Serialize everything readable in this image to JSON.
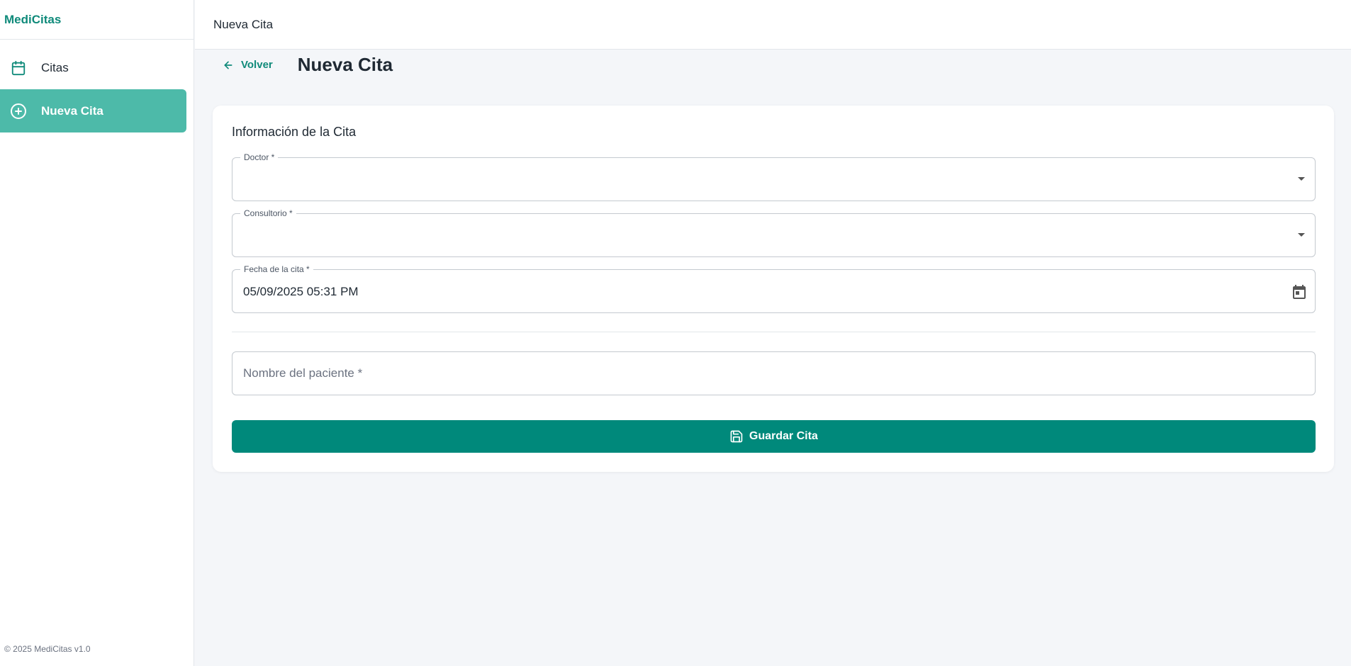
{
  "brand": {
    "name": "MediCitas",
    "color": "#0f8a7a"
  },
  "sidebar": {
    "items": [
      {
        "label": "Citas",
        "icon": "calendar-icon",
        "active": false
      },
      {
        "label": "Nueva Cita",
        "icon": "plus-circle-icon",
        "active": true
      }
    ],
    "footer": "© 2025 MediCitas v1.0"
  },
  "topbar": {
    "title": "Nueva Cita"
  },
  "header": {
    "back_label": "Volver",
    "title": "Nueva Cita"
  },
  "form": {
    "section_title": "Información de la Cita",
    "doctor": {
      "label": "Doctor *",
      "value": ""
    },
    "consultorio": {
      "label": "Consultorio *",
      "value": ""
    },
    "fecha": {
      "label": "Fecha de la cita *",
      "value": "05/09/2025 05:31 PM"
    },
    "paciente": {
      "placeholder": "Nombre del paciente *",
      "value": ""
    },
    "save_label": "Guardar Cita"
  },
  "colors": {
    "accent": "#00897b",
    "active_nav": "#4dbaa9"
  }
}
